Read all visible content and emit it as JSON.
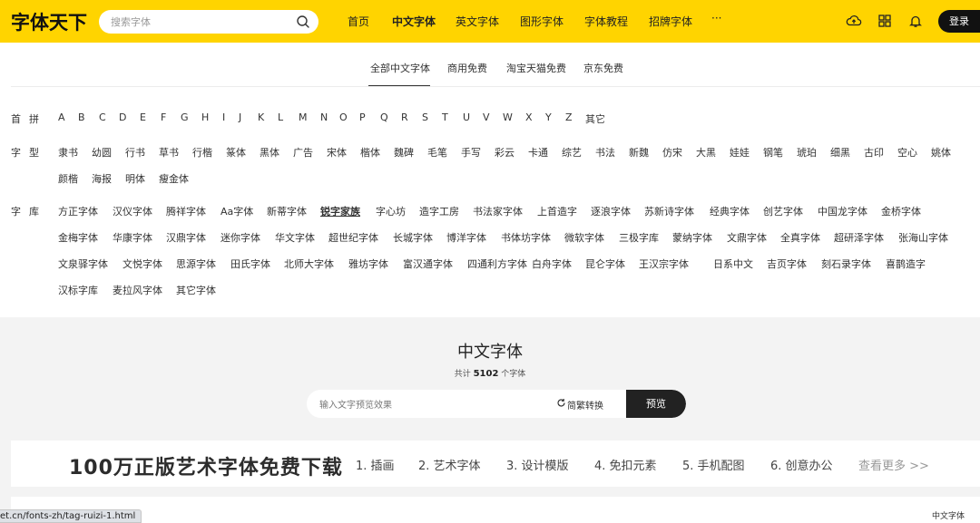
{
  "header": {
    "logo": "字体天下",
    "search_placeholder": "搜索字体",
    "nav": [
      "首页",
      "中文字体",
      "英文字体",
      "图形字体",
      "字体教程",
      "招牌字体",
      "···"
    ],
    "login": "登录"
  },
  "tabs": [
    "全部中文字体",
    "商用免费",
    "淘宝天猫免费",
    "京东免费"
  ],
  "filters": {
    "pinyin_label": "首拼",
    "pinyin": [
      "A",
      "B",
      "C",
      "D",
      "E",
      "F",
      "G",
      "H",
      "I",
      "J",
      "K",
      "L",
      "M",
      "N",
      "O",
      "P",
      "Q",
      "R",
      "S",
      "T",
      "U",
      "V",
      "W",
      "X",
      "Y",
      "Z",
      "其它"
    ],
    "type_label": "字型",
    "types": [
      "隶书",
      "幼圆",
      "行书",
      "草书",
      "行楷",
      "篆体",
      "黑体",
      "广告",
      "宋体",
      "楷体",
      "魏碑",
      "毛笔",
      "手写",
      "彩云",
      "卡通",
      "综艺",
      "书法",
      "新魏",
      "仿宋",
      "大黑",
      "娃娃",
      "钢笔",
      "琥珀",
      "细黑",
      "古印",
      "空心",
      "姚体",
      "颜楷",
      "海报",
      "明体",
      "瘦金体"
    ],
    "library_label": "字库",
    "libraries": [
      "方正字体",
      "汉仪字体",
      "腾祥字体",
      "Aa字体",
      "新蒂字体",
      "锐字家族",
      "字心坊",
      "造字工房",
      "书法家字体",
      "上首造字",
      "逐浪字体",
      "苏新诗字体",
      "经典字体",
      "创艺字体",
      "中国龙字体",
      "金桥字体",
      "金梅字体",
      "华康字体",
      "汉鼎字体",
      "迷你字体",
      "华文字体",
      "超世纪字体",
      "长城字体",
      "博洋字体",
      "书体坊字体",
      "微软字体",
      "三极字库",
      "蒙纳字体",
      "文鼎字体",
      "全真字体",
      "超研泽字体",
      "张海山字体",
      "文泉驿字体",
      "文悦字体",
      "思源字体",
      "田氏字体",
      "北师大字体",
      "雅坊字体",
      "富汉通字体",
      "四通利方字体",
      "白舟字体",
      "昆仑字体",
      "王汉宗字体",
      "日系中文",
      "吉页字体",
      "刻石录字体",
      "喜鹊造字",
      "汉标字库",
      "麦拉风字体",
      "其它字体"
    ]
  },
  "section": {
    "title": "中文字体",
    "count_prefix": "共计",
    "count": "5102",
    "count_suffix": "个字体",
    "preview_placeholder": "输入文字预览效果",
    "convert_label": "简繁转换",
    "preview_button": "预览"
  },
  "banner": {
    "title": "100万正版艺术字体免费下载",
    "items": [
      "1. 插画",
      "2. 艺术字体",
      "3. 设计模版",
      "4. 免扣元素",
      "5. 手机配图",
      "6. 创意办公"
    ],
    "more": "查看更多 >>"
  },
  "bottom_label": "中文字体",
  "status_url": "et.cn/fonts-zh/tag-ruizi-1.html",
  "colors": {
    "header_bg": "#FFD400",
    "dark": "#222222",
    "gray_bg": "#F3F3F3"
  }
}
